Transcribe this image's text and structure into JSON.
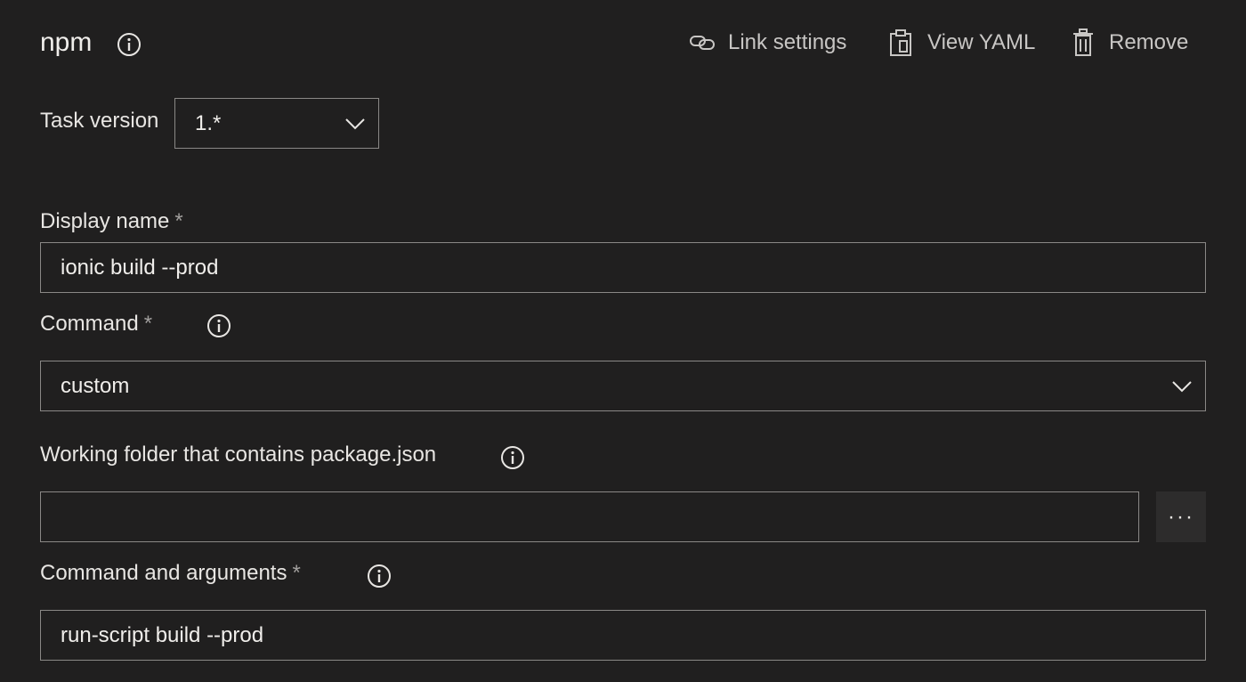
{
  "header": {
    "title": "npm",
    "link_settings_label": "Link settings",
    "view_yaml_label": "View YAML",
    "remove_label": "Remove"
  },
  "task_version": {
    "label": "Task version",
    "value": "1.*"
  },
  "display_name": {
    "label": "Display name",
    "required_mark": "*",
    "value": "ionic build --prod"
  },
  "command": {
    "label": "Command",
    "required_mark": "*",
    "value": "custom"
  },
  "working_folder": {
    "label": "Working folder that contains package.json",
    "value": "",
    "browse_label": "···"
  },
  "command_args": {
    "label": "Command and arguments",
    "required_mark": "*",
    "value": "run-script build --prod"
  },
  "colors": {
    "background": "#201f1f",
    "border": "#8a8886",
    "text": "#e8e6e3",
    "muted": "#c8c6c4"
  }
}
